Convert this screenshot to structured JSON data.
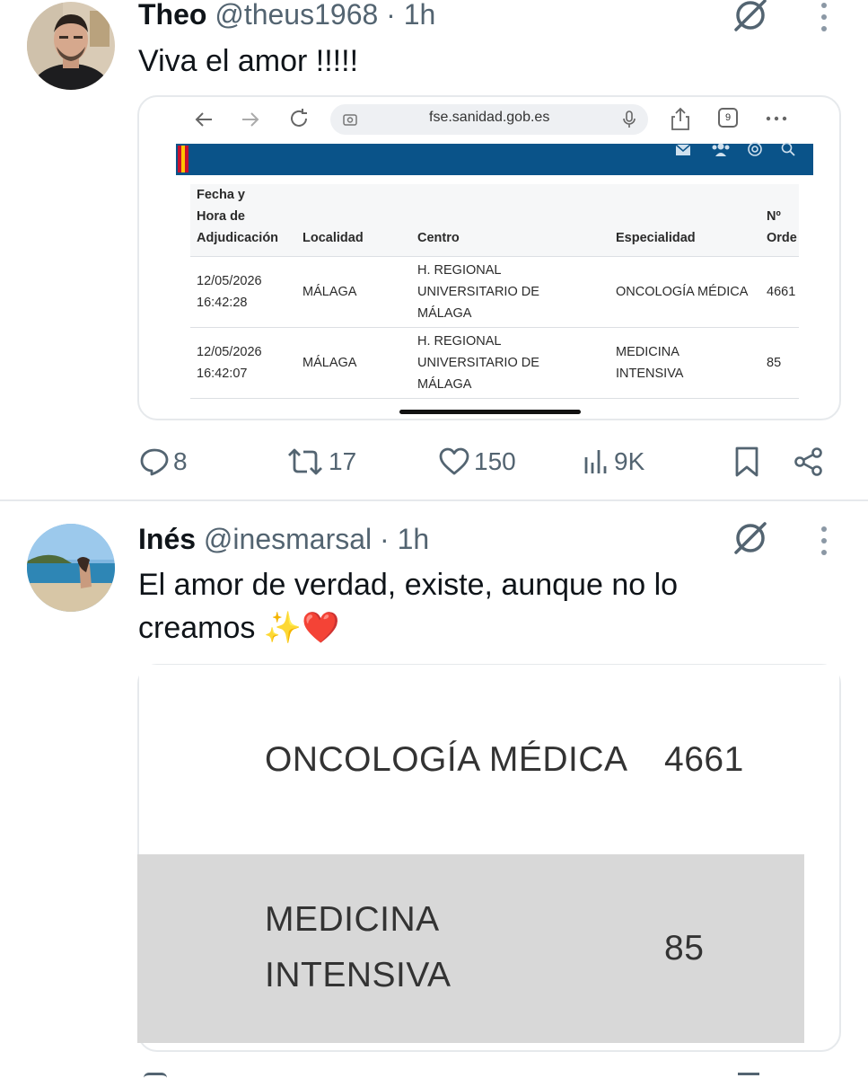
{
  "tweets": [
    {
      "author": {
        "name": "Theo",
        "handle": "@theus1968",
        "time": "1h"
      },
      "text": "Viva el amor !!!!!",
      "media": {
        "browser": {
          "url": "fse.sanidad.gob.es",
          "tab_count": "9"
        },
        "table": {
          "headers": {
            "fecha": [
              "Fecha y",
              "Hora de",
              "Adjudicación"
            ],
            "localidad": "Localidad",
            "centro": "Centro",
            "especialidad": "Especialidad",
            "orden": [
              "Nº",
              "Orde"
            ]
          },
          "rows": [
            {
              "fecha": [
                "12/05/2026",
                "16:42:28"
              ],
              "localidad": "MÁLAGA",
              "centro": [
                "H. REGIONAL",
                "UNIVERSITARIO DE",
                "MÁLAGA"
              ],
              "especialidad": [
                "ONCOLOGÍA MÉDICA"
              ],
              "orden": "4661"
            },
            {
              "fecha": [
                "12/05/2026",
                "16:42:07"
              ],
              "localidad": "MÁLAGA",
              "centro": [
                "H. REGIONAL",
                "UNIVERSITARIO DE",
                "MÁLAGA"
              ],
              "especialidad": [
                "MEDICINA",
                "INTENSIVA"
              ],
              "orden": "85"
            }
          ]
        }
      },
      "actions": {
        "replies": "8",
        "reposts": "17",
        "likes": "150",
        "views": "9K"
      }
    },
    {
      "author": {
        "name": "Inés",
        "handle": "@inesmarsal",
        "time": "1h"
      },
      "text_line1": "El amor de verdad, existe, aunque no lo",
      "text_line2": "creamos ✨❤️",
      "media": {
        "row1": {
          "specialty": "ONCOLOGÍA MÉDICA",
          "number": "4661"
        },
        "row2": {
          "specialty_line1": "MEDICINA",
          "specialty_line2": "INTENSIVA",
          "number": "85"
        }
      }
    }
  ],
  "separator": "·",
  "icons": [
    "grok-icon",
    "more-vertical-icon",
    "reply-icon",
    "repost-icon",
    "like-icon",
    "views-icon",
    "bookmark-icon",
    "share-icon",
    "back-arrow-icon",
    "forward-arrow-icon",
    "reload-icon",
    "mic-icon",
    "share-page-icon",
    "tabs-icon",
    "overflow-icon",
    "mail-icon",
    "people-icon",
    "at-icon",
    "search-icon"
  ],
  "colors": {
    "text": "#0f1419",
    "secondary": "#536471",
    "site_header": "#0a5389",
    "divider": "#e6e9ec",
    "zoom_grey": "#d8d8d8"
  }
}
